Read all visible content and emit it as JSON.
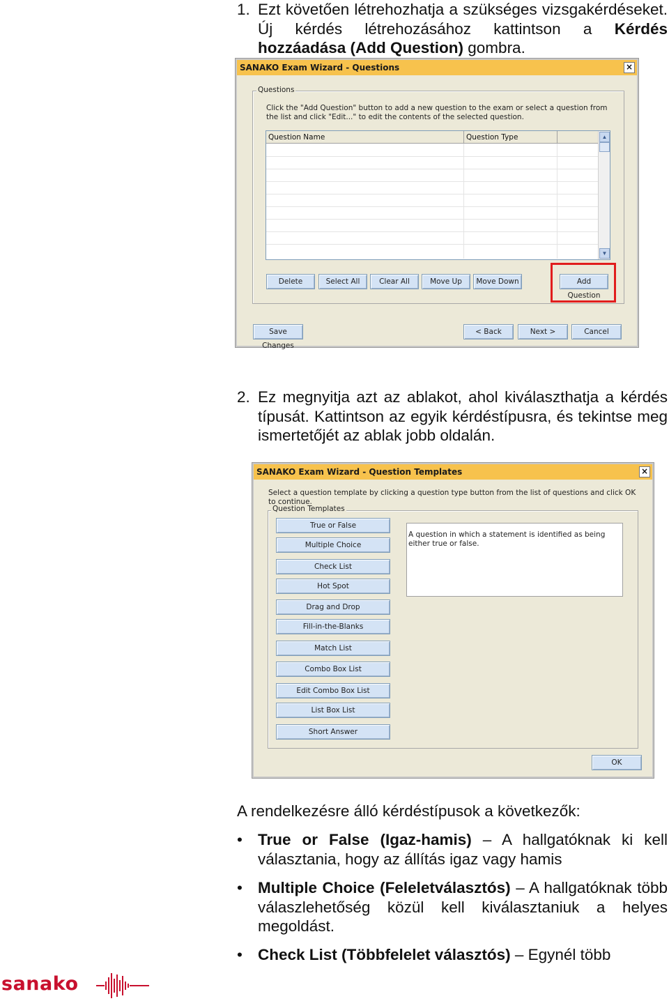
{
  "step1": {
    "number": "1.",
    "text_start": "Ezt követően létrehozhatja a szükséges vizsgakérdéseket. Új kérdés létrehozásához kattintson a ",
    "bold": "Kérdés hozzáadása (Add Question)",
    "text_end": " gombra."
  },
  "window1": {
    "title": "SANAKO Exam Wizard - Questions",
    "close": "×",
    "group_label": "Questions",
    "instruction": "Click the \"Add Question\" button to add a new question to the exam or select a question from the list and click \"Edit...\" to edit the contents of the selected question.",
    "columns": [
      "Question Name",
      "Question Type"
    ],
    "buttons": {
      "delete": "Delete",
      "select_all": "Select All",
      "clear_all": "Clear All",
      "move_up": "Move Up",
      "move_down": "Move Down",
      "add_question": "Add Question",
      "save_changes": "Save Changes",
      "back": "< Back",
      "next": "Next >",
      "cancel": "Cancel"
    }
  },
  "step2": {
    "number": "2.",
    "text": "Ez megnyitja azt az ablakot, ahol kiválaszthatja a kérdés típusát. Kattintson az egyik kérdéstípusra, és tekintse meg ismertetőjét az ablak jobb oldalán."
  },
  "window2": {
    "title": "SANAKO Exam Wizard - Question Templates",
    "close": "×",
    "instruction": "Select a question template by clicking a question type button from the list of questions and click OK to continue.",
    "group_label": "Question Templates",
    "templates": [
      "True or False",
      "Multiple Choice",
      "Check List",
      "Hot Spot",
      "Drag and Drop",
      "Fill-in-the-Blanks",
      "Match List",
      "Combo Box List",
      "Edit Combo Box List",
      "List Box List",
      "Short Answer"
    ],
    "description": "A question in which a statement is identified as being either true or false.",
    "ok": "OK"
  },
  "intro": "A rendelkezésre álló kérdéstípusok a következők:",
  "bullets": [
    {
      "bold": "True or False (Igaz-hamis)",
      "text": " – A hallgatóknak ki kell választania, hogy az állítás igaz vagy hamis"
    },
    {
      "bold": "Multiple Choice (Feleletválasztós)",
      "text": " – A hallgatóknak több válaszlehetőség közül kell kiválasztaniuk a helyes megoldást."
    },
    {
      "bold": "Check List (Többfelelet választós)",
      "text": " – Egynél több"
    }
  ],
  "bullet_symbol": "•",
  "logo": {
    "text": "sanako",
    "color": "#c8102e"
  }
}
